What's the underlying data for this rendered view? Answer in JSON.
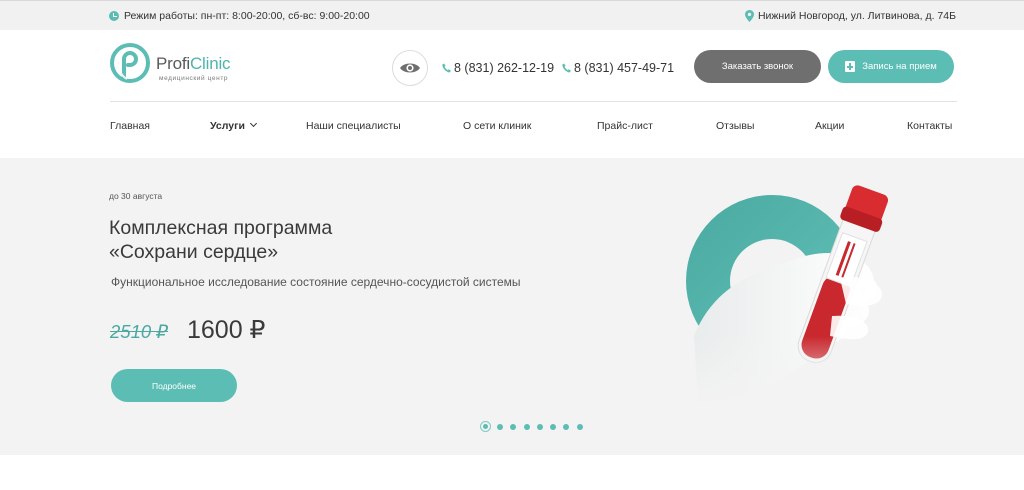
{
  "topbar": {
    "hours": "Режим работы: пн-пт: 8:00-20:00, сб-вс: 9:00-20:00",
    "address": "Нижний Новгород, ул. Литвинова, д. 74Б"
  },
  "logo": {
    "name_part1": "Profi",
    "name_part2": "Clinic",
    "subtitle": "медицинский центр"
  },
  "header": {
    "phone1": "8 (831) 262-12-19",
    "phone2": "8 (831) 457-49-71",
    "call_button": "Заказать звонок",
    "appointment_button": "Запись на прием"
  },
  "nav": {
    "items": [
      "Главная",
      "Услуги",
      "Наши специалисты",
      "О сети клиник",
      "Прайс-лист",
      "Отзывы",
      "Акции",
      "Контакты"
    ],
    "active_index": 1
  },
  "hero": {
    "until": "до 30 августа",
    "title_line1": "Комплексная программа",
    "title_line2": "«Сохрани сердце»",
    "description": "Функциональное исследование состояние сердечно-сосудистой системы",
    "old_price": "2510 ₽",
    "price": "1600 ₽",
    "more_button": "Подробнее"
  },
  "slider": {
    "count": 8,
    "active": 1
  },
  "colors": {
    "accent": "#5cbdb4",
    "dark_button": "#6f6f6f",
    "hero_bg": "#f3f3f3",
    "topbar_bg": "#f1f1f1"
  },
  "icons": [
    "clock-icon",
    "location-pin-icon",
    "eye-icon",
    "phone-icon",
    "medical-plus-icon"
  ]
}
